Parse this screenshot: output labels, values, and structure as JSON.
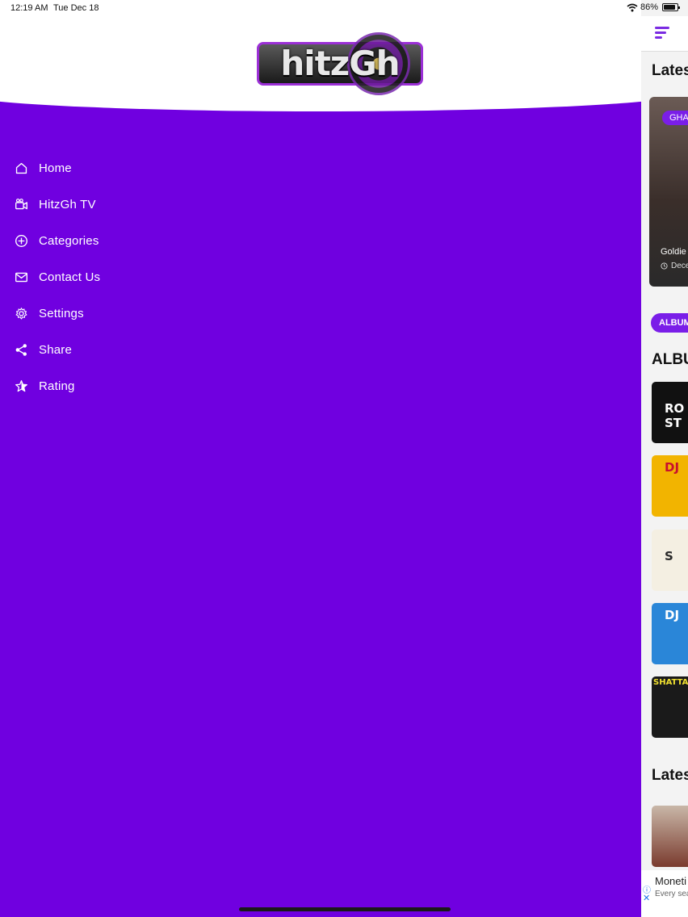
{
  "status_bar": {
    "time": "12:19 AM",
    "date": "Tue Dec 18",
    "battery": "86%"
  },
  "drawer": {
    "logo_text": "hitzGh",
    "background_color": "#7000e0",
    "menu": [
      {
        "label": "Home",
        "icon": "home-icon"
      },
      {
        "label": "HitzGh TV",
        "icon": "tv-camera-icon"
      },
      {
        "label": "Categories",
        "icon": "plus-circle-icon"
      },
      {
        "label": "Contact Us",
        "icon": "envelope-icon"
      },
      {
        "label": "Settings",
        "icon": "gear-icon"
      },
      {
        "label": "Share",
        "icon": "share-icon"
      },
      {
        "label": "Rating",
        "icon": "star-icon"
      }
    ]
  },
  "main": {
    "latest_title": "Lates",
    "featured_card": {
      "tag": "GHA",
      "title": "Goldie",
      "date": "Dece"
    },
    "album_pill": "ALBUM",
    "albums_title": "ALBU",
    "thumbs": [
      {
        "text": "RO\nST",
        "bg": "#111111",
        "fg": "#ffffff"
      },
      {
        "text": "DJ",
        "bg": "#f2b400",
        "fg": "#c8102e"
      },
      {
        "text": "S",
        "bg": "#f4efe2",
        "fg": "#2a2a2a"
      },
      {
        "text": "DJ",
        "bg": "#2a86d8",
        "fg": "#ffffff"
      },
      {
        "text": "SHATTA",
        "bg": "#1a1a1a",
        "fg": "#f0e030"
      }
    ],
    "latest_title_2": "Lates",
    "ad": {
      "title": "Moneti",
      "subtitle": "Every sea"
    }
  }
}
